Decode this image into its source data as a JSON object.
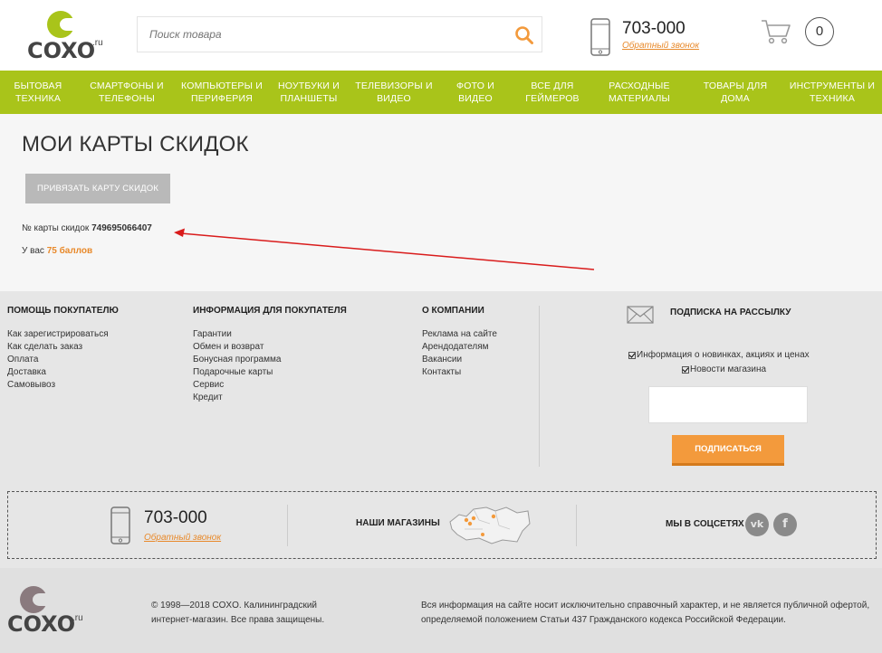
{
  "header": {
    "logo_text": "COXO",
    "logo_suffix": ".ru",
    "search_placeholder": "Поиск товара",
    "phone": "703-000",
    "callback": "Обратный звонок",
    "cart_count": "0"
  },
  "nav": [
    {
      "label": "Бытовая техника"
    },
    {
      "label": "Смартфоны и телефоны"
    },
    {
      "label": "Компьютеры и периферия"
    },
    {
      "label": "Ноутбуки и планшеты"
    },
    {
      "label": "Телевизоры и видео"
    },
    {
      "label": "Фото и видео"
    },
    {
      "label": "Все для геймеров"
    },
    {
      "label": "Расходные материалы"
    },
    {
      "label": "Товары для дома"
    },
    {
      "label": "Инструменты и техника"
    }
  ],
  "main": {
    "title": "МОИ КАРТЫ СКИДОК",
    "bind_button": "Привязать карту скидок",
    "card_label": "№ карты скидок",
    "card_number": "749695066407",
    "bonus_label": "У вас",
    "bonus_value": "75 баллов"
  },
  "footer": {
    "col1": {
      "title": "Помощь покупателю",
      "items": [
        "Как зарегистрироваться",
        "Как сделать заказ",
        "Оплата",
        "Доставка",
        "Самовывоз"
      ]
    },
    "col2": {
      "title": "Информация для покупателя",
      "items": [
        "Гарантии",
        "Обмен и возврат",
        "Бонусная программа",
        "Подарочные карты",
        "Сервис",
        "Кредит"
      ]
    },
    "col3": {
      "title": "О компании",
      "items": [
        "Реклама на сайте",
        "Арендодателям",
        "Вакансии",
        "Контакты"
      ]
    },
    "subscribe": {
      "title": "Подписка на рассылку",
      "check1": "Информация о новинках, акциях и ценах",
      "check2": "Новости магазина",
      "button": "Подписаться"
    },
    "contacts": {
      "phone": "703-000",
      "callback": "Обратный звонок",
      "shops": "Наши магазины",
      "social": "Мы в соцсетях",
      "vk": "vk",
      "fb": "f"
    },
    "copyright": "© 1998—2018 COXO. Калининградский интернет-магазин. Все права защищены.",
    "disclaimer": "Вся информация на сайте носит исключительно справочный характер, и не является публичной офертой, определяемой положением Статьи 437 Гражданского кодекса Российской Федерации."
  },
  "colors": {
    "accent_green": "#a9c41a",
    "accent_orange": "#e8892a"
  }
}
